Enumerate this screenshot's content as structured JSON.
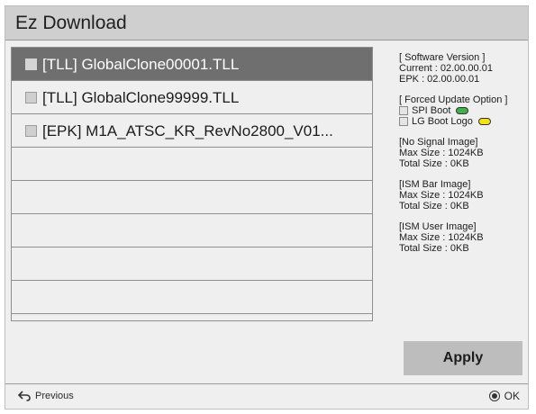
{
  "window": {
    "title": "Ez Download"
  },
  "files": [
    {
      "label": "[TLL] GlobalClone00001.TLL",
      "selected": true
    },
    {
      "label": "[TLL] GlobalClone99999.TLL",
      "selected": false
    },
    {
      "label": "[EPK] M1A_ATSC_KR_RevNo2800_V01...",
      "selected": false
    },
    {
      "label": ""
    },
    {
      "label": ""
    },
    {
      "label": ""
    },
    {
      "label": ""
    },
    {
      "label": ""
    }
  ],
  "software": {
    "heading": "[ Software Version ]",
    "current": "Current : 02.00.00.01",
    "epk": "EPK : 02.00.00.01"
  },
  "forced_update": {
    "heading": "[ Forced Update Option ]",
    "spi_boot": {
      "label": "SPI Boot",
      "color": "#3fb04a"
    },
    "lg_boot_logo": {
      "label": "LG Boot Logo",
      "color": "#f2e21c"
    }
  },
  "images": [
    {
      "heading": "[No Signal Image]",
      "max": "Max Size : 1024KB",
      "total": "Total Size : 0KB"
    },
    {
      "heading": "[ISM Bar Image]",
      "max": "Max Size : 1024KB",
      "total": "Total Size : 0KB"
    },
    {
      "heading": "[ISM User Image]",
      "max": "Max Size : 1024KB",
      "total": "Total Size : 0KB"
    }
  ],
  "apply_label": "Apply",
  "footer": {
    "previous_label": "Previous",
    "ok_label": "OK",
    "previous_icon": "back-arrow-icon",
    "ok_icon": "ok-button-icon"
  }
}
